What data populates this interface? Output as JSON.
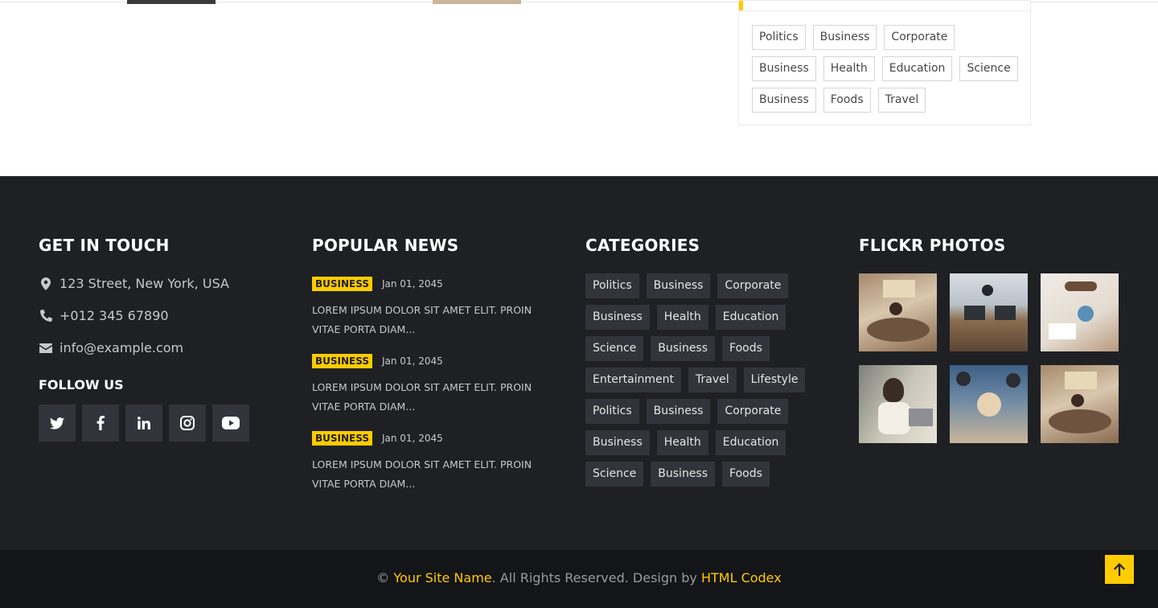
{
  "sidebar_tags": [
    "Politics",
    "Business",
    "Corporate",
    "Business",
    "Health",
    "Education",
    "Science",
    "Business",
    "Foods",
    "Travel"
  ],
  "footer": {
    "contact": {
      "title": "GET IN TOUCH",
      "address": "123 Street, New York, USA",
      "phone": "+012 345 67890",
      "email": "info@example.com",
      "icons": [
        "map-marker-icon",
        "phone-icon",
        "envelope-icon"
      ]
    },
    "follow": {
      "title": "FOLLOW US",
      "networks": [
        "twitter-icon",
        "facebook-icon",
        "linkedin-icon",
        "instagram-icon",
        "youtube-icon"
      ]
    },
    "popular_news": {
      "title": "POPULAR NEWS",
      "items": [
        {
          "category": "BUSINESS",
          "date": "Jan 01, 2045",
          "text": "LOREM IPSUM DOLOR SIT AMET ELIT. PROIN VITAE PORTA DIAM..."
        },
        {
          "category": "BUSINESS",
          "date": "Jan 01, 2045",
          "text": "LOREM IPSUM DOLOR SIT AMET ELIT. PROIN VITAE PORTA DIAM..."
        },
        {
          "category": "BUSINESS",
          "date": "Jan 01, 2045",
          "text": "LOREM IPSUM DOLOR SIT AMET ELIT. PROIN VITAE PORTA DIAM..."
        }
      ]
    },
    "categories": {
      "title": "CATEGORIES",
      "items": [
        "Politics",
        "Business",
        "Corporate",
        "Business",
        "Health",
        "Education",
        "Science",
        "Business",
        "Foods",
        "Entertainment",
        "Travel",
        "Lifestyle",
        "Politics",
        "Business",
        "Corporate",
        "Business",
        "Health",
        "Education",
        "Science",
        "Business",
        "Foods"
      ]
    },
    "flickr": {
      "title": "FLICKR PHOTOS",
      "photos": [
        "team-meeting-photo",
        "office-laptops-photo",
        "handshake-charts-photo",
        "woman-laptop-photo",
        "team-hands-photo",
        "team-meeting-photo"
      ]
    }
  },
  "copyright": {
    "symbol": "©",
    "site_name": "Your Site Name",
    "middle": ". All Rights Reserved. Design by ",
    "designer": "HTML Codex"
  },
  "back_to_top": "arrow-up-icon",
  "colors": {
    "accent": "#ffcc00",
    "footer_bg": "#1e2024",
    "copyright_bg": "#141518",
    "tag_dark_bg": "#31343a"
  }
}
